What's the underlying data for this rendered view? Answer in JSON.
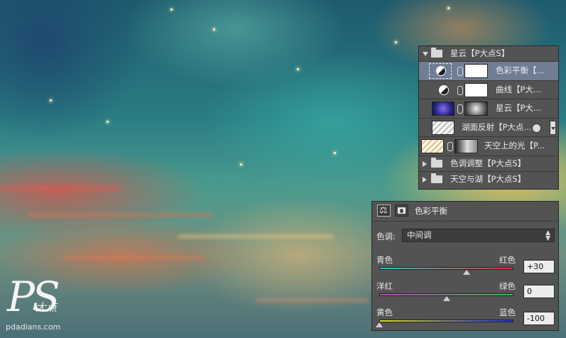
{
  "layers": [
    {
      "name": "星云【P大点S】",
      "kind": "group",
      "expanded": true
    },
    {
      "name": "色彩平衡【...",
      "kind": "adjustment",
      "selected": true
    },
    {
      "name": "曲线【P大...",
      "kind": "adjustment"
    },
    {
      "name": "星云【P大...",
      "kind": "image"
    },
    {
      "name": "湖面反射【P大点...",
      "kind": "image-fx"
    },
    {
      "name": "天空上的光【P...",
      "kind": "image"
    },
    {
      "name": "色调调整【P大点S】",
      "kind": "group",
      "expanded": false
    },
    {
      "name": "天空与湖【P大点S】",
      "kind": "group",
      "expanded": false
    }
  ],
  "properties": {
    "title": "色彩平衡",
    "tone_label": "色调:",
    "tone_value": "中间调",
    "sliders": [
      {
        "left": "青色",
        "right": "红色",
        "value": "+30",
        "position": 30,
        "colors": [
          "#27c7c4",
          "#e1332e"
        ]
      },
      {
        "left": "洋红",
        "right": "绿色",
        "value": "0",
        "position": 0,
        "colors": [
          "#c93fd0",
          "#38c43a"
        ]
      },
      {
        "left": "黄色",
        "right": "蓝色",
        "value": "-100",
        "position": -100,
        "colors": [
          "#e6e12a",
          "#2233d4"
        ]
      }
    ]
  },
  "watermark": {
    "logo": "PS",
    "small": "大点",
    "url": "pdadians.com"
  }
}
